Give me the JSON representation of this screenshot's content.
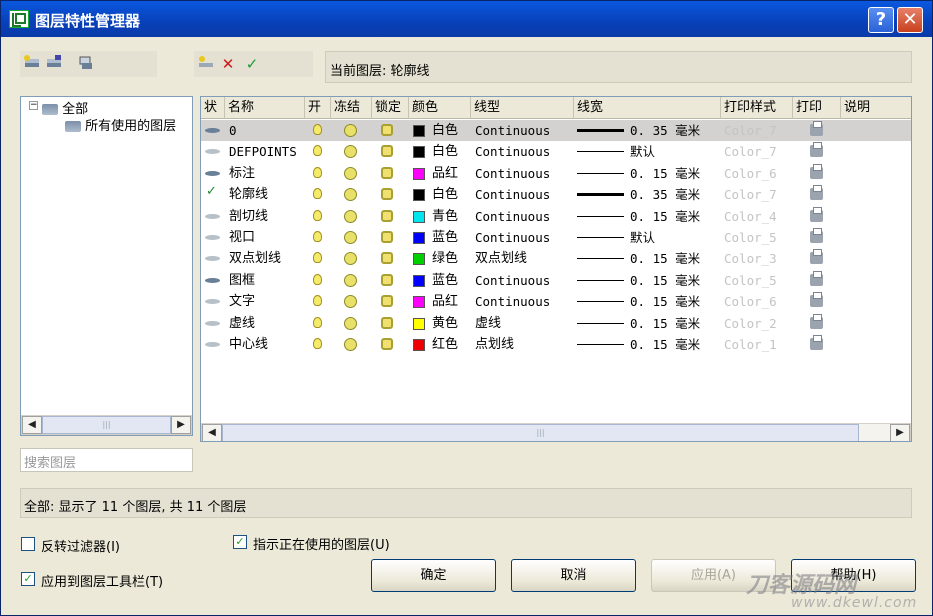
{
  "window": {
    "title": "图层特性管理器",
    "help_btn": "?",
    "close_btn": "✕"
  },
  "current_layer_text": "当前图层: 轮廓线",
  "toolbar_icons": [
    "new-layer-icon",
    "layer-state-icon",
    "layer-filter-icon",
    "new-layer-icon",
    "delete-layer-icon",
    "set-current-icon"
  ],
  "tree": {
    "root": "全部",
    "child": "所有使用的图层"
  },
  "search_placeholder": "搜索图层",
  "columns": [
    "状",
    "名称",
    "开",
    "冻结",
    "锁定",
    "颜色",
    "线型",
    "线宽",
    "打印样式",
    "打印",
    "说明"
  ],
  "layers": [
    {
      "status": "flat-dark",
      "name": "0",
      "on": true,
      "color_name": "白色",
      "color": "#000000",
      "linetype": "Continuous",
      "lineweight": "0. 35 毫米",
      "thick": true,
      "plot_style": "Color_7",
      "selected": true
    },
    {
      "status": "flat",
      "name": "DEFPOINTS",
      "on": true,
      "color_name": "白色",
      "color": "#000000",
      "linetype": "Continuous",
      "lineweight": "默认",
      "thick": false,
      "plot_style": "Color_7",
      "selected": false
    },
    {
      "status": "flat-dark",
      "name": "标注",
      "on": true,
      "color_name": "品红",
      "color": "#ff00ff",
      "linetype": "Continuous",
      "lineweight": "0. 15 毫米",
      "thick": false,
      "plot_style": "Color_6",
      "selected": false
    },
    {
      "status": "check",
      "name": "轮廓线",
      "on": true,
      "color_name": "白色",
      "color": "#000000",
      "linetype": "Continuous",
      "lineweight": "0. 35 毫米",
      "thick": true,
      "plot_style": "Color_7",
      "selected": false
    },
    {
      "status": "flat",
      "name": "剖切线",
      "on": true,
      "color_name": "青色",
      "color": "#00e5ee",
      "linetype": "Continuous",
      "lineweight": "0. 15 毫米",
      "thick": false,
      "plot_style": "Color_4",
      "selected": false
    },
    {
      "status": "flat",
      "name": "视口",
      "on": true,
      "color_name": "蓝色",
      "color": "#0000ff",
      "linetype": "Continuous",
      "lineweight": "默认",
      "thick": false,
      "plot_style": "Color_5",
      "selected": false
    },
    {
      "status": "flat",
      "name": "双点划线",
      "on": true,
      "color_name": "绿色",
      "color": "#00d000",
      "linetype": "双点划线",
      "lineweight": "0. 15 毫米",
      "thick": false,
      "plot_style": "Color_3",
      "selected": false
    },
    {
      "status": "flat-dark",
      "name": "图框",
      "on": true,
      "color_name": "蓝色",
      "color": "#0000ff",
      "linetype": "Continuous",
      "lineweight": "0. 15 毫米",
      "thick": false,
      "plot_style": "Color_5",
      "selected": false
    },
    {
      "status": "flat",
      "name": "文字",
      "on": true,
      "color_name": "品红",
      "color": "#ff00ff",
      "linetype": "Continuous",
      "lineweight": "0. 15 毫米",
      "thick": false,
      "plot_style": "Color_6",
      "selected": false
    },
    {
      "status": "flat",
      "name": "虚线",
      "on": true,
      "color_name": "黄色",
      "color": "#ffff00",
      "linetype": "虚线",
      "lineweight": "0. 15 毫米",
      "thick": false,
      "plot_style": "Color_2",
      "selected": false
    },
    {
      "status": "flat",
      "name": "中心线",
      "on": true,
      "color_name": "红色",
      "color": "#ee0000",
      "linetype": "点划线",
      "lineweight": "0. 15 毫米",
      "thick": false,
      "plot_style": "Color_1",
      "selected": false
    }
  ],
  "status_text": "全部: 显示了 11 个图层, 共 11 个图层",
  "options": {
    "invert_filter": {
      "label": "反转过滤器(I)",
      "checked": false
    },
    "apply_toolbar": {
      "label": "应用到图层工具栏(T)",
      "checked": true
    },
    "indicate_used": {
      "label": "指示正在使用的图层(U)",
      "checked": true
    }
  },
  "buttons": {
    "ok": "确定",
    "cancel": "取消",
    "apply": "应用(A)",
    "help": "帮助(H)"
  },
  "watermark": {
    "line1": "刀客源码网",
    "line2": "www.dkewl.com"
  }
}
